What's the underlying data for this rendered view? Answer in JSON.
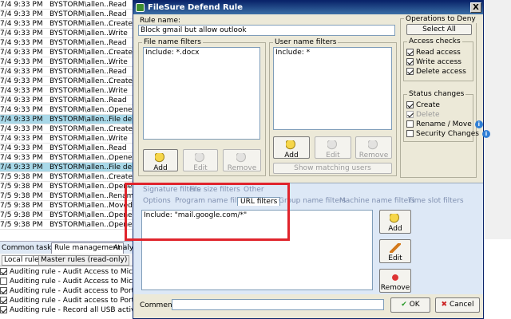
{
  "log_rows": [
    {
      "time": "7/4 9:33 PM",
      "user": "BYSTORM\\allen...",
      "action": "Read",
      "selected": false
    },
    {
      "time": "7/4 9:33 PM",
      "user": "BYSTORM\\allen...",
      "action": "Read",
      "selected": false
    },
    {
      "time": "7/4 9:33 PM",
      "user": "BYSTORM\\allen...",
      "action": "Created",
      "selected": false
    },
    {
      "time": "7/4 9:33 PM",
      "user": "BYSTORM\\allen...",
      "action": "Write",
      "selected": false
    },
    {
      "time": "7/4 9:33 PM",
      "user": "BYSTORM\\allen...",
      "action": "Read",
      "selected": false
    },
    {
      "time": "7/4 9:33 PM",
      "user": "BYSTORM\\allen...",
      "action": "Created",
      "selected": false
    },
    {
      "time": "7/4 9:33 PM",
      "user": "BYSTORM\\allen...",
      "action": "Write",
      "selected": false
    },
    {
      "time": "7/4 9:33 PM",
      "user": "BYSTORM\\allen...",
      "action": "Read",
      "selected": false
    },
    {
      "time": "7/4 9:33 PM",
      "user": "BYSTORM\\allen...",
      "action": "Created",
      "selected": false
    },
    {
      "time": "7/4 9:33 PM",
      "user": "BYSTORM\\allen...",
      "action": "Write",
      "selected": false
    },
    {
      "time": "7/4 9:33 PM",
      "user": "BYSTORM\\allen...",
      "action": "Read",
      "selected": false
    },
    {
      "time": "7/4 9:33 PM",
      "user": "BYSTORM\\allen...",
      "action": "Opened",
      "selected": false
    },
    {
      "time": "7/4 9:33 PM",
      "user": "BYSTORM\\allen...",
      "action": "File dele",
      "selected": true
    },
    {
      "time": "7/4 9:33 PM",
      "user": "BYSTORM\\allen...",
      "action": "Created",
      "selected": false
    },
    {
      "time": "7/4 9:33 PM",
      "user": "BYSTORM\\allen...",
      "action": "Write",
      "selected": false
    },
    {
      "time": "7/4 9:33 PM",
      "user": "BYSTORM\\allen...",
      "action": "Read",
      "selected": false
    },
    {
      "time": "7/4 9:33 PM",
      "user": "BYSTORM\\allen...",
      "action": "Opened",
      "selected": false
    },
    {
      "time": "7/4 9:33 PM",
      "user": "BYSTORM\\allen...",
      "action": "File dele",
      "selected": true
    },
    {
      "time": "7/5 9:38 PM",
      "user": "BYSTORM\\allen...",
      "action": "Create",
      "selected": false
    },
    {
      "time": "7/5 9:38 PM",
      "user": "BYSTORM\\allen...",
      "action": "Opened",
      "selected": false
    },
    {
      "time": "7/5 9:38 PM",
      "user": "BYSTORM\\allen...",
      "action": "Renam",
      "selected": false
    },
    {
      "time": "7/5 9:38 PM",
      "user": "BYSTORM\\allen...",
      "action": "Moved",
      "selected": false
    },
    {
      "time": "7/5 9:38 PM",
      "user": "BYSTORM\\allen...",
      "action": "Opene",
      "selected": false
    },
    {
      "time": "7/5 9:38 PM",
      "user": "BYSTORM\\allen...",
      "action": "Opene",
      "selected": false
    }
  ],
  "bottom_tabs": {
    "common": "Common tasks",
    "rules": "Rule management",
    "analysis": "Analys"
  },
  "sub_tabs": {
    "local": "Local rules",
    "master": "Master rules (read-only)"
  },
  "rules_list": [
    {
      "label": "Auditing rule - Audit Access to Microsoft Office",
      "checked": true
    },
    {
      "label": "Auditing rule - Audit Access to Microsoft Office",
      "checked": false
    },
    {
      "label": "Auditing rule - Audit access to Portable Documents",
      "checked": true
    },
    {
      "label": "Auditing rule - Audit access to Portable Documents",
      "checked": true
    },
    {
      "label": "Auditing rule - Record all USB activity",
      "checked": true
    }
  ],
  "dialog": {
    "title": "FileSure Defend Rule",
    "close": "X",
    "rule_name_label": "Rule name:",
    "rule_name_value": "Block gmail but allow outlook",
    "file_filters_title": "File name filters",
    "file_filters_value": "Include: *.docx",
    "user_filters_title": "User name filters",
    "user_filters_value": "Include: *",
    "add": "Add",
    "edit": "Edit",
    "remove": "Remove",
    "show_matching_users": "Show matching users",
    "operations_title": "Operations to Deny",
    "select_all": "Select All",
    "access_checks_title": "Access checks",
    "access_checks": [
      {
        "label": "Read access",
        "checked": true,
        "disabled": false
      },
      {
        "label": "Write access",
        "checked": true,
        "disabled": false
      },
      {
        "label": "Delete access",
        "checked": true,
        "disabled": false
      }
    ],
    "status_changes_title": "Status changes",
    "status_changes": [
      {
        "label": "Create",
        "checked": true,
        "disabled": false,
        "info": false
      },
      {
        "label": "Delete",
        "checked": true,
        "disabled": true,
        "info": false
      },
      {
        "label": "Rename / Move",
        "checked": false,
        "disabled": false,
        "info": true
      },
      {
        "label": "Security Changes",
        "checked": false,
        "disabled": false,
        "info": true
      }
    ],
    "filter_tabs_row1": [
      "Signature filters",
      "File size filters",
      "Other"
    ],
    "filter_tabs_row2": [
      "Options",
      "Program name filters",
      "URL filters",
      "Group name filters",
      "Machine name filters",
      "Time slot filters"
    ],
    "url_filters_value": "Include: \"mail.google.com/*\"",
    "comment_label": "Comment:",
    "comment_value": "",
    "ok": "OK",
    "cancel": "Cancel"
  },
  "colors": {
    "accent_red": "#e0242c",
    "title_bar": "#0a246a",
    "selected_row": "#a8d8e8"
  }
}
